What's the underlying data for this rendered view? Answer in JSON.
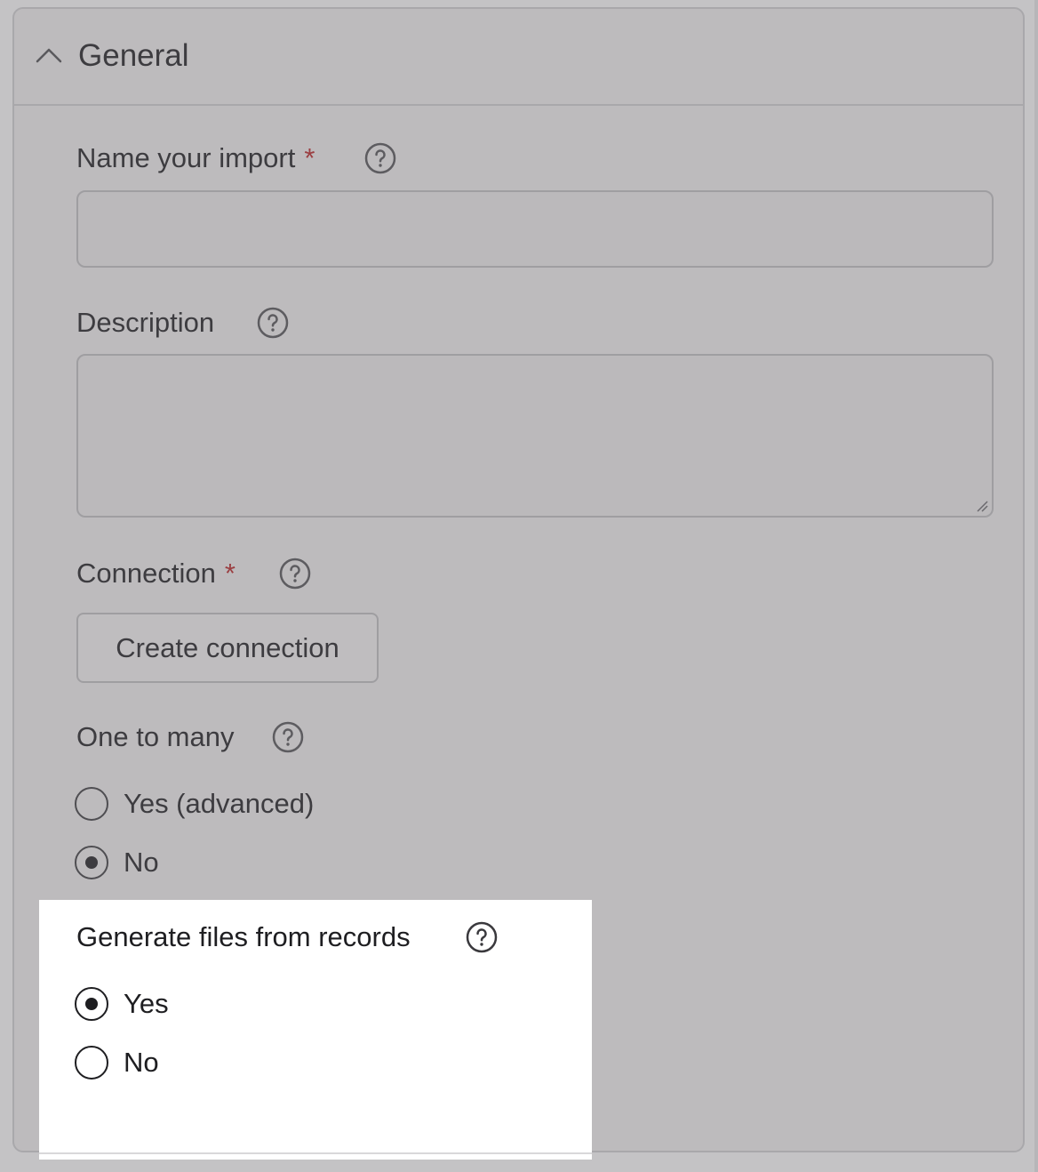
{
  "section": {
    "title": "General",
    "expanded": true
  },
  "fields": {
    "name": {
      "label": "Name your import",
      "required_mark": "*",
      "value": "",
      "placeholder": ""
    },
    "description": {
      "label": "Description",
      "value": "",
      "placeholder": ""
    },
    "connection": {
      "label": "Connection",
      "required_mark": "*",
      "button_label": "Create connection"
    },
    "one_to_many": {
      "label": "One to many",
      "options": [
        {
          "label": "Yes (advanced)",
          "selected": false
        },
        {
          "label": "No",
          "selected": true
        }
      ]
    },
    "generate_files": {
      "label": "Generate files from records",
      "options": [
        {
          "label": "Yes",
          "selected": true
        },
        {
          "label": "No",
          "selected": false
        }
      ]
    }
  },
  "icons": {
    "collapse": "chevron-up-icon",
    "help": "help-circle-icon"
  },
  "colors": {
    "overlay": "#c4c3c5",
    "highlight": "#ffffff",
    "required": "#9b3f42"
  }
}
